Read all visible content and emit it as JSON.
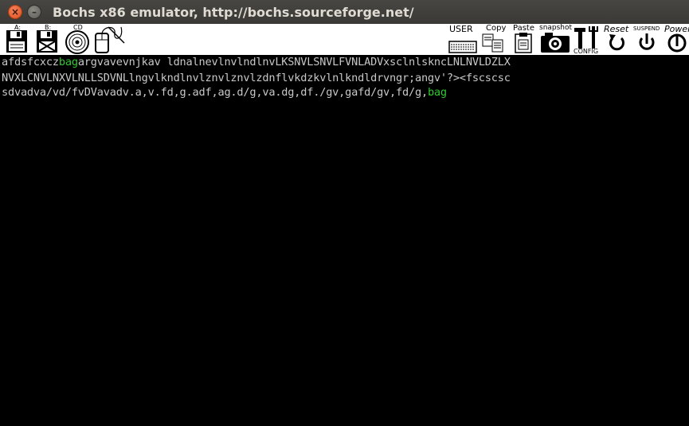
{
  "window": {
    "title": "Bochs x86 emulator, http://bochs.sourceforge.net/",
    "close_glyph": "×",
    "minimize_glyph": "–"
  },
  "toolbar": {
    "floppy_a_label": "A:",
    "floppy_b_label": "B:",
    "cdrom_label": "CD",
    "user_label": "USER",
    "copy_label": "Copy",
    "paste_label": "Paste",
    "snapshot_label": "snapshot",
    "config_label": "CONFIG",
    "reset_label": "Reset",
    "suspend_label": "SUSPEND",
    "power_label": "Power"
  },
  "screen": {
    "line1_a": "afdsfcxcz",
    "line1_hl": "bag",
    "line1_b": "argvavevnjkav ldnalnevlnvlndlnvLKSNVLSNVLFVNLADVxsclnlskncLNLNVLDZLX",
    "line2": "NVXLCNVLNXVLNLLSDVNLlngvlkndlnvlznvlznvlzdnflvkdzkvlnlkndldrvngr;angv'?><fscscsc",
    "line3_a": "sdvadva/vd/fvDVavadv.a,v.fd,g.adf,ag.d/g,va.dg,df./gv,gafd/gv,fd/g,",
    "line3_hl": "bag"
  },
  "colors": {
    "titlebar": "#3d3c38",
    "close": "#e95420",
    "screen_bg": "#000000",
    "text": "#c8c8c8",
    "highlight": "#2fc92f"
  }
}
